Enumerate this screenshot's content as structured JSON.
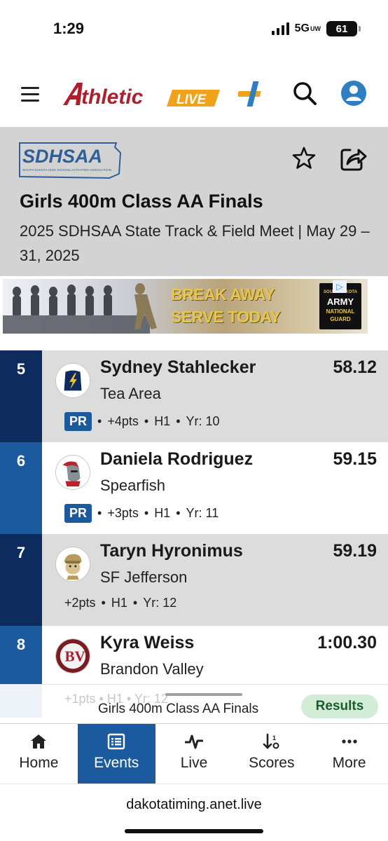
{
  "status_bar": {
    "time": "1:29",
    "network": "5G",
    "network_sub": "UW",
    "battery": "61"
  },
  "app_header": {
    "brand_main": "thletic",
    "brand_live": "LIVE",
    "icons": [
      "menu-icon",
      "plus-icon",
      "search-icon",
      "account-icon"
    ],
    "brand_colors": {
      "red": "#b01e2e",
      "orange": "#f0a21a",
      "blue": "#2d7fc1"
    }
  },
  "meet": {
    "org": "SDHSAA",
    "org_full": "SOUTH DAKOTA HIGH SCHOOL ACTIVITIES ASSOCIATION",
    "event_title": "Girls 400m Class AA Finals",
    "meet_name": "2025 SDHSAA State Track & Field Meet | May 29 – 31, 2025"
  },
  "ad": {
    "line1": "BREAK AWAY",
    "line2": "SERVE TODAY",
    "badge_top": "SOUTH DAKOTA",
    "badge_main": "ARMY",
    "badge_sub": "NATIONAL GUARD"
  },
  "results": [
    {
      "place": "5",
      "name": "Sydney Stahlecker",
      "mark": "58.12",
      "school": "Tea Area",
      "pr": "PR",
      "points": "+4pts",
      "heat": "H1",
      "year": "Yr: 10"
    },
    {
      "place": "6",
      "name": "Daniela Rodriguez",
      "mark": "59.15",
      "school": "Spearfish",
      "pr": "PR",
      "points": "+3pts",
      "heat": "H1",
      "year": "Yr: 11"
    },
    {
      "place": "7",
      "name": "Taryn Hyronimus",
      "mark": "59.19",
      "school": "SF Jefferson",
      "pr": "",
      "points": "+2pts",
      "heat": "H1",
      "year": "Yr: 12"
    },
    {
      "place": "8",
      "name": "Kyra Weiss",
      "mark": "1:00.30",
      "school": "Brandon Valley",
      "pr": "",
      "points": "+1pts",
      "heat": "H1",
      "year": "Yr: 12"
    }
  ],
  "now_bar": {
    "ghost": "+1pts • H1 • Yr: 12",
    "title": "Girls 400m Class AA Finals",
    "chip": "Results"
  },
  "nav": {
    "items": [
      {
        "label": "Home",
        "icon": "home-icon"
      },
      {
        "label": "Events",
        "icon": "list-icon",
        "active": true
      },
      {
        "label": "Live",
        "icon": "pulse-icon"
      },
      {
        "label": "Scores",
        "icon": "sort-icon"
      },
      {
        "label": "More",
        "icon": "more-icon"
      }
    ]
  },
  "browser": {
    "url": "dakotatiming.anet.live"
  }
}
